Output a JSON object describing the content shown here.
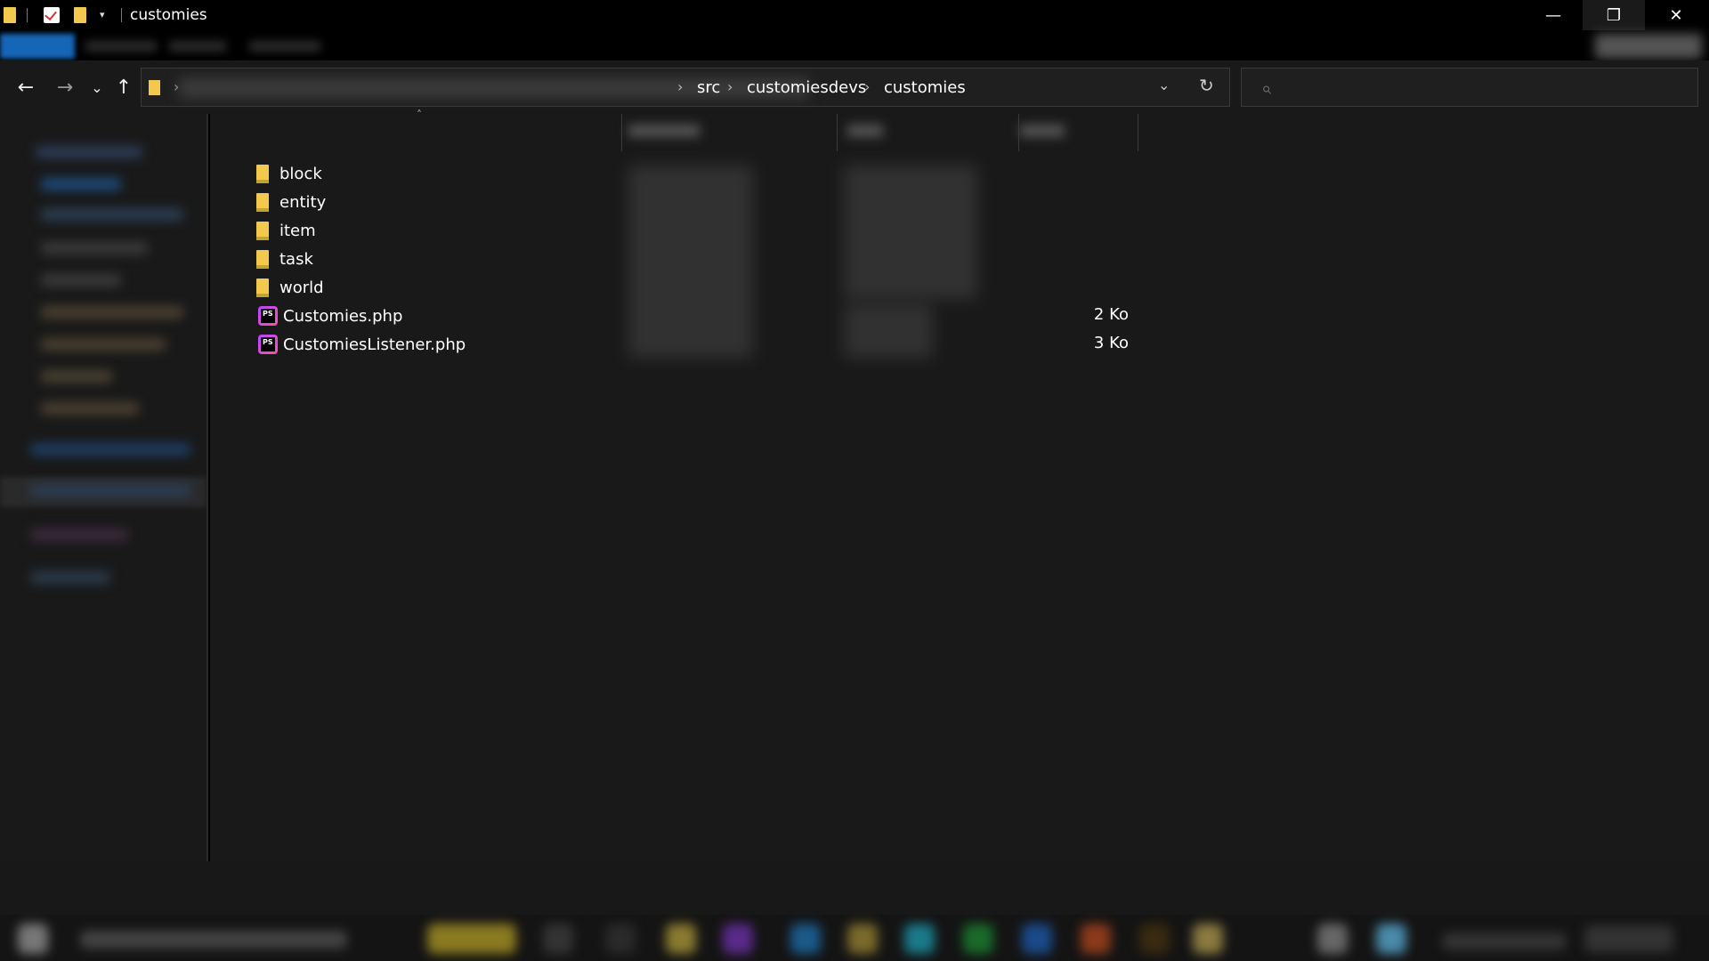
{
  "window": {
    "title": "customies",
    "controls": {
      "minimize": "—",
      "maximize": "❐",
      "close": "✕"
    }
  },
  "quick_access": {
    "dropdown": "▾"
  },
  "nav": {
    "back": "←",
    "forward": "→",
    "recent": "⌄",
    "up": "↑"
  },
  "address_bar": {
    "crumbs": [
      "src",
      "customiesdevs",
      "customies"
    ],
    "separator": "›",
    "dropdown": "⌄",
    "refresh": "↻"
  },
  "search": {
    "icon": "search-icon",
    "glyph": "⌕"
  },
  "files": [
    {
      "name": "block",
      "type": "folder",
      "size": ""
    },
    {
      "name": "entity",
      "type": "folder",
      "size": ""
    },
    {
      "name": "item",
      "type": "folder",
      "size": ""
    },
    {
      "name": "task",
      "type": "folder",
      "size": ""
    },
    {
      "name": "world",
      "type": "folder",
      "size": ""
    },
    {
      "name": "Customies.php",
      "type": "phpstorm-file",
      "size": "2 Ko"
    },
    {
      "name": "CustomiesListener.php",
      "type": "phpstorm-file",
      "size": "3 Ko"
    }
  ],
  "file_icon_text": "PS",
  "sort_indicator": "˄",
  "colors": {
    "background": "#191919",
    "folder": "#f2c94c",
    "file_tab": "#1666b8"
  }
}
